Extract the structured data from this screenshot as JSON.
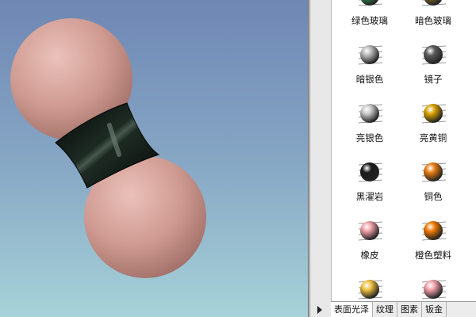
{
  "materials": [
    {
      "label": "绿色玻璃",
      "icon": "green-glass-ball-icon",
      "color": "#2f8f4a"
    },
    {
      "label": "暗色玻璃",
      "icon": "dark-glass-ball-icon",
      "color": "#8a6a2a"
    },
    {
      "label": "暗银色",
      "icon": "dark-silver-ball-icon",
      "color": "#b8b8b8"
    },
    {
      "label": "镜子",
      "icon": "mirror-ball-icon",
      "color": "#5a5a5a"
    },
    {
      "label": "亮银色",
      "icon": "bright-silver-ball-icon",
      "color": "#c8c8c8"
    },
    {
      "label": "亮黄铜",
      "icon": "bright-brass-ball-icon",
      "color": "#d9a000"
    },
    {
      "label": "黑濯岩",
      "icon": "black-rock-ball-icon",
      "color": "#1a1a1a"
    },
    {
      "label": "铜色",
      "icon": "copper-ball-icon",
      "color": "#e67c12"
    },
    {
      "label": "橡皮",
      "icon": "rubber-ball-icon",
      "color": "#f0a0a8"
    },
    {
      "label": "橙色塑料",
      "icon": "orange-plastic-ball-icon",
      "color": "#f07800"
    },
    {
      "label": "",
      "icon": "yellow-ball-icon",
      "color": "#f0c040"
    },
    {
      "label": "",
      "icon": "pink-ball-icon",
      "color": "#f0a0a8"
    }
  ],
  "tabs": [
    "表面光泽",
    "纹理",
    "图素",
    "钣金"
  ],
  "model": {
    "ball_color": "#d49a92",
    "connector_color": "#0d1510"
  }
}
